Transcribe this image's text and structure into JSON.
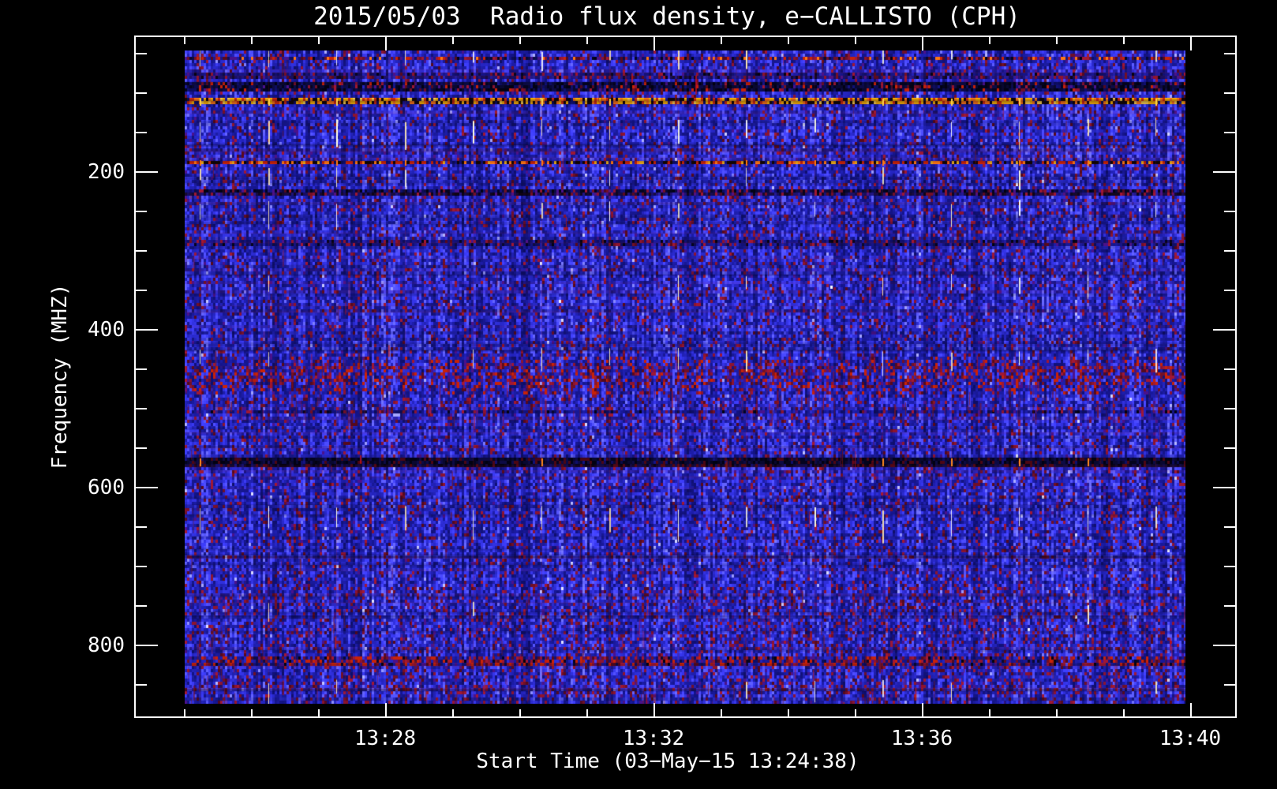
{
  "chart_data": {
    "type": "heatmap",
    "title": "2015/05/03  Radio flux density, e−CALLISTO (CPH)",
    "xlabel": "Start Time (03−May−15 13:24:38)",
    "ylabel": "Frequency (MHZ)",
    "x_tick_labels": [
      "13:28",
      "13:32",
      "13:36",
      "13:40"
    ],
    "x_minor_tick_interval": "1 minute",
    "x_start_time": "13:24:38",
    "x_end_time": "13:40",
    "y_tick_labels": [
      "200",
      "400",
      "600",
      "800"
    ],
    "y_minor_tick_interval_mhz": 50,
    "y_range_mhz": [
      45,
      874
    ],
    "y_axis_inverted": true,
    "grid": false,
    "legend": "none",
    "colormap_description": "blue background noise with dark-red speckles; RFI bands in yellow/orange/red/black; white one-minute calibration dashes",
    "palette": {
      "background": "#000000",
      "axis_and_text": "#ffffff",
      "blue_bright": "#3a35f2",
      "blue_mid": "#2420cc",
      "blue_dark": "#141068",
      "navy_black": "#04041f",
      "maroon_speckles": [
        "#550a1e",
        "#701028",
        "#8c1430",
        "#a01834",
        "#4a128c"
      ],
      "bright_red": "#c82208",
      "orange": "#ff7712",
      "amber": "#ffb400",
      "yellow": "#ffd24a",
      "white_marker": "#ffffff"
    },
    "rfi_bands_mhz": [
      {
        "from": 54,
        "to": 59,
        "style": "speck",
        "desc": "thin speckled red/dark interference line near top"
      },
      {
        "from": 76,
        "to": 83,
        "style": "milddark",
        "desc": "weak dark speckled row"
      },
      {
        "from": 87,
        "to": 99,
        "style": "dark",
        "desc": "dark navy/black absorption band (FM range)"
      },
      {
        "from": 107,
        "to": 116,
        "style": "fm",
        "desc": "bright yellow/orange/red barcode RFI band"
      },
      {
        "from": 185,
        "to": 192,
        "style": "redbar",
        "desc": "red/orange barcode RFI line"
      },
      {
        "from": 223,
        "to": 230,
        "style": "darkspeck",
        "desc": "dark speckled band with maroon"
      },
      {
        "from": 288,
        "to": 296,
        "style": "milddark",
        "desc": "faint dark line"
      },
      {
        "from": 436,
        "to": 483,
        "style": "blotch",
        "desc": "diffuse red blotchy interference region"
      },
      {
        "from": 501,
        "to": 507,
        "style": "mildred",
        "desc": "faint red/dark thin band"
      },
      {
        "from": 563,
        "to": 573,
        "style": "black",
        "desc": "strong black band with dark-red speckles"
      },
      {
        "from": 815,
        "to": 827,
        "style": "redband",
        "desc": "red speckled band near bottom"
      }
    ],
    "minute_markers": {
      "count": 15,
      "interval": "≈1 minute",
      "appearance": "short vertical white/cream dashes at several heights, orange through RFI bands"
    }
  }
}
